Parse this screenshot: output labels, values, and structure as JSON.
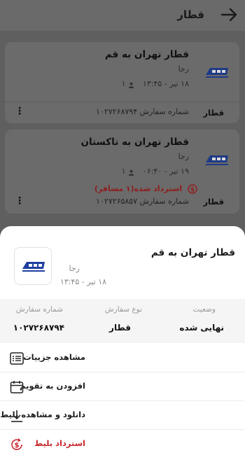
{
  "header": {
    "title": "قطار"
  },
  "cards": [
    {
      "title": "قطار تهران به قم",
      "operator": "رجا",
      "datetime": "۱۸ تیر - ۱۳:۴۵",
      "passengers": "۱",
      "refund_status": "",
      "type_label": "قطار",
      "order_text": "شماره سفارش ۱۰۲۷۲۶۸۷۹۴"
    },
    {
      "title": "قطار تهران به تاکستان",
      "operator": "رجا",
      "datetime": "۱۹ تیر - ۰۶:۴۰",
      "passengers": "۱",
      "refund_status": "استرداد شده(۱ مسافر)",
      "type_label": "قطار",
      "order_text": "شماره سفارش ۱۰۲۷۲۶۵۸۵۷"
    }
  ],
  "sheet": {
    "title": "قطار تهران به قم",
    "operator": "رجا",
    "datetime": "۱۸ تیر - ۱۳:۴۵",
    "info": {
      "status_label": "وضعیت",
      "status_value": "نهایی شده",
      "type_label": "نوع سفارش",
      "type_value": "قطار",
      "order_label": "شماره سفارش",
      "order_value": "۱۰۲۷۲۶۸۷۹۴"
    },
    "actions": [
      {
        "label": "مشاهده جزییات",
        "icon": "list-icon"
      },
      {
        "label": "افزودن به تقویم",
        "icon": "calendar-icon"
      },
      {
        "label": "دانلود و مشاهده بلیط",
        "icon": "download-icon"
      },
      {
        "label": "استرداد بلیط",
        "icon": "refund-icon"
      }
    ]
  },
  "colors": {
    "accent_red": "#c8262b",
    "brand_blue": "#1f3fa0"
  }
}
